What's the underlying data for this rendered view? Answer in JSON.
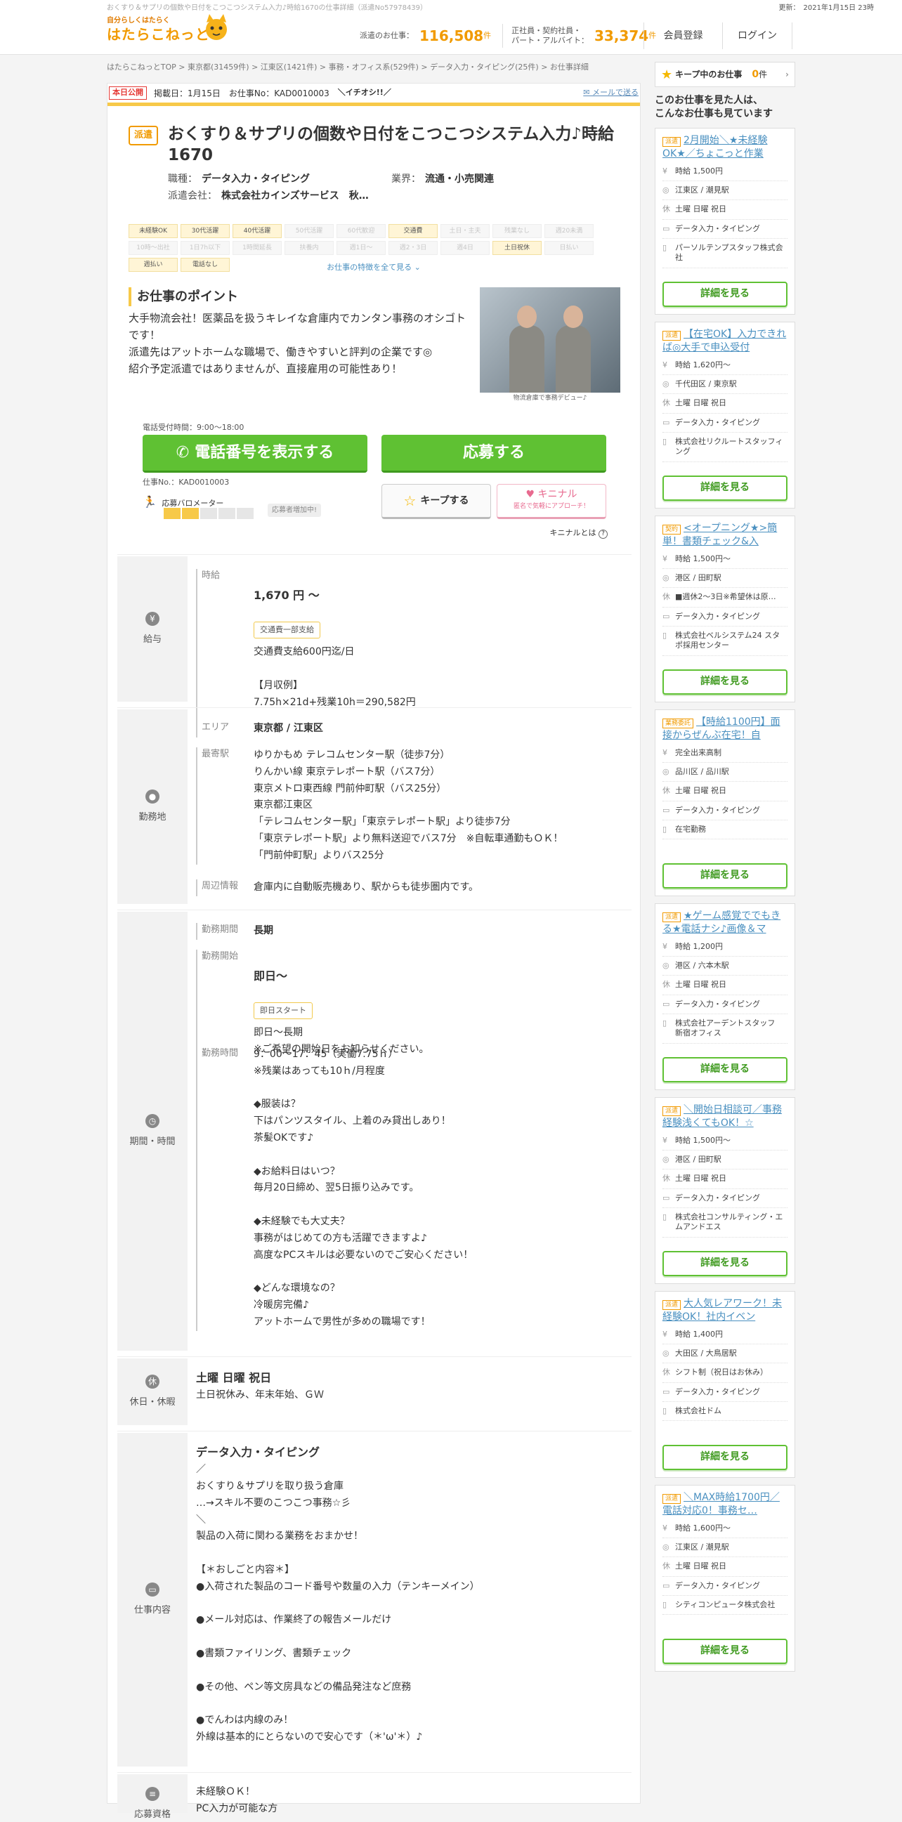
{
  "header": {
    "top_caption": "おくすり＆サプリの個数や日付をこつこつシステム入力♪時給1670の仕事詳細（派遣No57978439）",
    "updated": "更新：　2021年1月15日 23時",
    "logo_tag": "自分らしくはたらく",
    "logo_name": "はたらこねっと",
    "haken_label": "派遣のお仕事：",
    "haken_count": "116,508",
    "other_label": "正社員・契約社員・\nパート・アルバイト：",
    "other_count": "33,374",
    "unit": "件",
    "register": "会員登録",
    "login": "ログイン"
  },
  "breadcrumb": "はたらこねっとTOP > 東京都(31459件) > 江東区(1421件) > 事務・オフィス系(529件) > データ入力・タイピング(25件) > お仕事詳細",
  "publish": {
    "badge": "本日公開",
    "date": "掲載日：1月15日",
    "job_no": "お仕事No：KAD0010003",
    "ichioshi": "＼イチオシ!!／",
    "mail": "メールで送る"
  },
  "job": {
    "type_badge": "派遣",
    "title": "おくすり＆サプリの個数や日付をこつこつシステム入力♪時給1670",
    "occupation_key": "職種：",
    "occupation": "データ入力・タイピング",
    "industry_key": "業界：",
    "industry": "流通・小売関連",
    "company_key": "派遣会社：",
    "company": "株式会社カインズサービス　秋…"
  },
  "chips": [
    {
      "label": "未経験OK",
      "on": true
    },
    {
      "label": "30代活躍",
      "on": true
    },
    {
      "label": "40代活躍",
      "on": true
    },
    {
      "label": "50代活躍",
      "on": false
    },
    {
      "label": "60代歓迎",
      "on": false
    },
    {
      "label": "交通費",
      "on": true
    },
    {
      "label": "土日・主夫",
      "on": false
    },
    {
      "label": "残業なし",
      "on": false
    },
    {
      "label": "週20未満",
      "on": false
    },
    {
      "label": "10時～出社",
      "on": false
    },
    {
      "label": "1日7h以下",
      "on": false
    },
    {
      "label": "1時間延長",
      "on": false
    },
    {
      "label": "扶養内",
      "on": false
    },
    {
      "label": "週1日～",
      "on": false
    },
    {
      "label": "週2・3日",
      "on": false
    },
    {
      "label": "週4日",
      "on": false
    },
    {
      "label": "土日祝休",
      "on": true
    },
    {
      "label": "日払い",
      "on": false
    },
    {
      "label": "週払い",
      "on": true
    },
    {
      "label": "電話なし",
      "on": true
    }
  ],
  "all_features": "お仕事の特徴を全て見る",
  "point": {
    "heading": "お仕事のポイント",
    "body": "大手物流会社！医薬品を扱うキレイな倉庫内でカンタン事務のオシゴトです！\n派遣先はアットホームな職場で、働きやすいと評判の企業です◎\n紹介予定派遣ではありませんが、直接雇用の可能性あり！",
    "photo_caption": "物流倉庫で事務デビュー♪"
  },
  "actions": {
    "tel_time": "電話受付時間：9:00～18:00",
    "tel_button": "電話番号を表示する",
    "apply_button": "応募する",
    "job_no": "仕事No.：KAD0010003",
    "param_label": "応募バロメーター",
    "param_level": 2,
    "param_max": 5,
    "increase": "応募者増加中!",
    "keep": "キープする",
    "kininaru": "キニナル",
    "kininaru_sub": "匿名で気軽にアプローチ！",
    "kininaru_help": "キニナルとは"
  },
  "salary": {
    "label": "給与",
    "key": "時給",
    "amount": "1,670 円 ～",
    "badge": "交通費一部支給",
    "detail": "交通費支給600円迄/日\n\n【月収例】\n7.75h×21d+残業10h＝290,582円"
  },
  "location": {
    "label": "勤務地",
    "area_key": "エリア",
    "area": "東京都 / 江東区",
    "station_key": "最寄駅",
    "station": "ゆりかもめ テレコムセンター駅（徒歩7分）\nりんかい線 東京テレポート駅（バス7分）\n東京メトロ東西線 門前仲町駅（バス25分）\n東京都江東区\n「テレコムセンター駅」「東京テレポート駅」より徒歩7分\n「東京テレポート駅」より無料送迎でバス7分　※自転車通勤もＯＫ！\n「門前仲町駅」よりバス25分",
    "around_key": "周辺情報",
    "around": "倉庫内に自動販売機あり、駅からも徒歩圏内です。"
  },
  "period": {
    "label": "期間・時間",
    "term_key": "勤務期間",
    "term": "長期",
    "start_key": "勤務開始",
    "start": "即日～",
    "start_badge": "即日スタート",
    "start_detail": "即日～長期\n※ご希望の開始日をお知らせください。",
    "time_key": "勤務時間",
    "time": "9：00～17：45（実働7.75ｈ）\n※残業はあっても10ｈ/月程度\n\n◆服装は？\n下はパンツスタイル、上着のみ貸出しあり！\n茶髪OKです♪\n\n◆お給料日はいつ？\n毎月20日締め、翌5日振り込みです。\n\n◆未経験でも大丈夫？\n事務がはじめての方も活躍できますよ♪\n高度なPCスキルは必要ないのでご安心ください！\n\n◆どんな環境なの？\n冷暖房完備♪\nアットホームで男性が多めの職場です！"
  },
  "holiday": {
    "icon": "休",
    "label": "休日・休暇",
    "main": "土曜 日曜 祝日",
    "detail": "土日祝休み、年末年始、ＧＷ"
  },
  "work": {
    "label": "仕事内容",
    "main": "データ入力・タイピング",
    "detail": "／\nおくすり＆サプリを取り扱う倉庫\n…→スキル不要のこつこつ事務☆彡\n＼\n製品の入荷に関わる業務をおまかせ！\n\n【＊おしごと内容＊】\n●入荷された製品のコード番号や数量の入力（テンキーメイン）\n\n●メール対応は、作業終了の報告メールだけ\n\n●書類ファイリング、書類チェック\n\n●その他、ペン等文房具などの備品発注など庶務\n\n●でんわは内線のみ！\n外線は基本的にとらないので安心です（＊'ω'＊）♪"
  },
  "qualification": {
    "label": "応募資格",
    "detail": "未経験ＯＫ！\nPC入力が可能な方"
  },
  "sidebar": {
    "keep_label": "キープ中のお仕事",
    "keep_count": "0",
    "keep_unit": "件",
    "heading": "このお仕事を見た人は、\nこんなお仕事も見ています",
    "detail_label": "詳細を見る",
    "cards": [
      {
        "tag": "派遣",
        "title": "2月開始＼★未経験OK★／ちょこっと作業",
        "wage": "時給 1,500円",
        "place": "江東区 / 潮見駅",
        "holiday": "土曜 日曜 祝日",
        "job": "データ入力・タイピング",
        "company": "パーソルテンプスタッフ株式会社"
      },
      {
        "tag": "派遣",
        "title": "【在宅OK】入力できれば◎大手で申込受付",
        "wage": "時給 1,620円～",
        "place": "千代田区 / 東京駅",
        "holiday": "土曜 日曜 祝日",
        "job": "データ入力・タイピング",
        "company": "株式会社リクルートスタッフィング"
      },
      {
        "tag": "契約",
        "title": "<オープニング★>簡単！書類チェック&入",
        "wage": "時給 1,500円～",
        "place": "港区 / 田町駅",
        "holiday": "■週休2～3日※希望休は原…",
        "job": "データ入力・タイピング",
        "company": "株式会社ベルシステム24 スタポ採用センター"
      },
      {
        "tag": "業務委託",
        "title": "【時給1100円】面接からぜんぶ在宅！自",
        "wage": "完全出来高制",
        "place": "品川区 / 品川駅",
        "holiday": "土曜 日曜 祝日",
        "job": "データ入力・タイピング",
        "company": "在宅勤務"
      },
      {
        "tag": "派遣",
        "title": "★ゲーム感覚ででもきる★電話ナシ♪画像＆マ",
        "wage": "時給 1,200円",
        "place": "港区 / 六本木駅",
        "holiday": "土曜 日曜 祝日",
        "job": "データ入力・タイピング",
        "company": "株式会社アーデントスタッフ　新宿オフィス"
      },
      {
        "tag": "派遣",
        "title": "＼開始日相談可／事務経験浅くてもOK！☆",
        "wage": "時給 1,500円～",
        "place": "港区 / 田町駅",
        "holiday": "土曜 日曜 祝日",
        "job": "データ入力・タイピング",
        "company": "株式会社コンサルティング・エムアンドエス"
      },
      {
        "tag": "派遣",
        "title": "大人気レアワーク！未経験OK！社内イベン",
        "wage": "時給 1,400円",
        "place": "大田区 / 大鳥居駅",
        "holiday": "シフト制（祝日はお休み）",
        "job": "データ入力・タイピング",
        "company": "株式会社ドム"
      },
      {
        "tag": "派遣",
        "title": "＼MAX時給1700円／電話対応0！事務セ…",
        "wage": "時給 1,600円～",
        "place": "江東区 / 潮見駅",
        "holiday": "土曜 日曜 祝日",
        "job": "データ入力・タイピング",
        "company": "シティコンピュータ株式会社"
      }
    ]
  },
  "colors": {
    "accent": "#f19a00",
    "green": "#5fc133",
    "yellow": "#f7c948",
    "link": "#4a90c0"
  }
}
